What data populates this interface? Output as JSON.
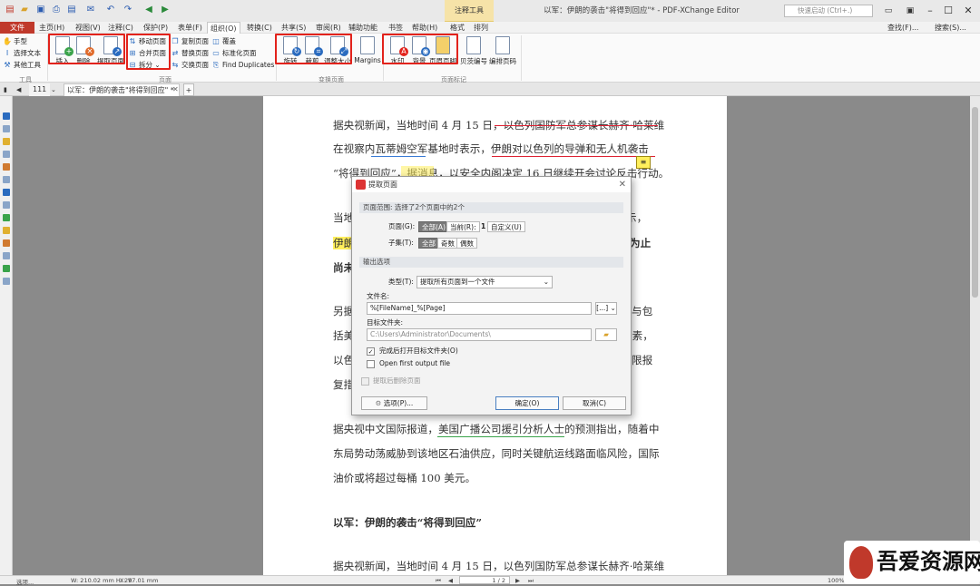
{
  "window": {
    "title": "以军：伊朗的袭击\"将得到回应\"* - PDF-XChange Editor",
    "contextual_tab": "注释工具",
    "quick_search_placeholder": "快速启动 (Ctrl+.)",
    "quick_access_icons": [
      "app-logo-icon",
      "open-icon",
      "save-icon",
      "print-icon",
      "scan-icon",
      "email-icon",
      "undo-icon",
      "redo-icon",
      "back-icon",
      "forward-icon"
    ]
  },
  "menu": {
    "items": [
      "文件",
      "主页(H)",
      "视图(V)",
      "注释(C)",
      "保护(P)",
      "表单(F)",
      "组织(O)",
      "转换(C)",
      "共享(S)",
      "审阅(R)",
      "辅助功能",
      "书签",
      "帮助(H)",
      "格式",
      "排列"
    ],
    "active": "组织(O)",
    "right_items": [
      "查找(F)...",
      "搜索(S)..."
    ]
  },
  "ribbon": {
    "tools_group": {
      "label": "工具",
      "items": [
        "手型",
        "选择文本",
        "其他工具"
      ]
    },
    "pages_group": {
      "label": "页面",
      "big_buttons": [
        "插入",
        "删除",
        "提取页面"
      ],
      "small_buttons": [
        "移动页面",
        "合并页面",
        "拆分",
        "复制页面",
        "替换页面",
        "交换页面",
        "覆盖",
        "标准化页面",
        "Find Duplicates"
      ]
    },
    "transform_group": {
      "label": "变换页面",
      "buttons": [
        "旋转",
        "裁剪",
        "调整大小",
        "Margins"
      ]
    },
    "marks_group": {
      "label": "页面标记",
      "buttons": [
        "水印",
        "背景",
        "页眉页脚",
        "贝茨编号",
        "编排页码"
      ]
    }
  },
  "tabs": {
    "left_tab": "111",
    "doc_tab": "以军：伊朗的袭击\"将得到回应\" *",
    "new_tab": "+"
  },
  "document": {
    "lines": [
      "据央视新闻，当地时间 4 月 15 日，以色列国防军总参谋长赫齐·哈莱维",
      "在视察内瓦蒂姆空军基地时表示，伊朗对以色列的导弹和无人机袭击",
      "“将得到回应”，据消息，以安全内阁决定 16 日继续开会讨论反击行动。",
      "当地",
      "示，",
      "伊朗",
      "为止",
      "尚未",
      "另据",
      "与包",
      "括美",
      "因素，",
      "以色",
      "限报",
      "复措",
      "据央视中文国际报道，美国广播公司援引分析人士的预测指出，随着中",
      "东局势动荡威胁到该地区石油供应，同时关键航运线路面临风险，国际",
      "油价或将超过每桶 100 美元。",
      "以军：伊朗的袭击“将得到回应”",
      "据央视新闻，当地时间 4 月 15 日，以色列国防军总参谋长赫齐·哈莱维"
    ]
  },
  "dialog": {
    "title": "提取页面",
    "page_range_section": "页面范围: 选择了2个页面中的2个",
    "pages_label": "页面(G):",
    "pages_options": [
      "全部(A)",
      "当前(R):",
      "1",
      "自定义(U)"
    ],
    "subset_label": "子集(T):",
    "subset_options": [
      "全部",
      "奇数",
      "偶数"
    ],
    "output_section": "输出选项",
    "type_label": "类型(T):",
    "type_value": "提取所有页面到一个文件",
    "filename_label": "文件名:",
    "filename_value": "%[FileName]_%[Page]",
    "macro_button": "[...] ⌄",
    "folder_label": "目标文件夹:",
    "folder_value": "C:\\Users\\Administrator\\Documents\\",
    "open_folder_label": "完成后打开目标文件夹(O)",
    "open_folder_checked": true,
    "open_first_label": "Open first output file",
    "open_first_checked": false,
    "delete_after_label": "提取后删除页面",
    "options_button": "选项(P)...",
    "ok_button": "确定(O)",
    "cancel_button": "取消(C)"
  },
  "statusbar": {
    "mode": "选项...",
    "size": "W: 210.02 mm  H: 297.01 mm",
    "coords": "X:  Y:",
    "page_indicator": "1 / 2",
    "zoom": "100%"
  },
  "watermark": {
    "text": "吾爱资源网"
  },
  "colors": {
    "accent_red": "#e2221b",
    "file_menu": "#c0392b",
    "highlight": "#ffef5c",
    "contextual": "#f6e3a8"
  }
}
